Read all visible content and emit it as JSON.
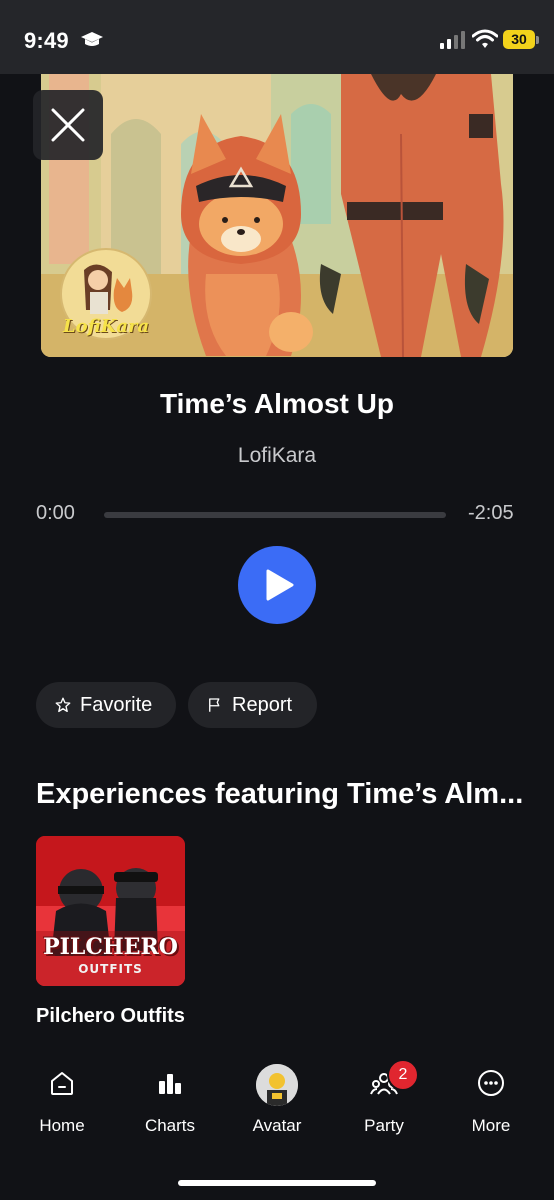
{
  "status_bar": {
    "time": "9:49",
    "battery": "30"
  },
  "artwork": {
    "logo_text": "LofiKara"
  },
  "track": {
    "title": "Time’s Almost Up",
    "artist": "LofiKara"
  },
  "player": {
    "elapsed": "0:00",
    "remaining": "-2:05",
    "progress": 0
  },
  "actions": {
    "favorite_label": "Favorite",
    "report_label": "Report"
  },
  "experiences": {
    "heading": "Experiences featuring Time’s Alm...",
    "items": [
      {
        "name": "Pilchero Outfits",
        "thumb_text": "PILCHERO",
        "thumb_subtext": "OUTFITS"
      }
    ]
  },
  "nav": {
    "items": [
      {
        "label": "Home",
        "icon": "home-icon"
      },
      {
        "label": "Charts",
        "icon": "charts-icon"
      },
      {
        "label": "Avatar",
        "icon": "avatar-icon"
      },
      {
        "label": "Party",
        "icon": "party-icon",
        "badge": "2"
      },
      {
        "label": "More",
        "icon": "more-icon"
      }
    ]
  },
  "colors": {
    "accent": "#3b6cf6",
    "background": "#111216",
    "badge": "#e0262f",
    "battery": "#f2d21b"
  }
}
